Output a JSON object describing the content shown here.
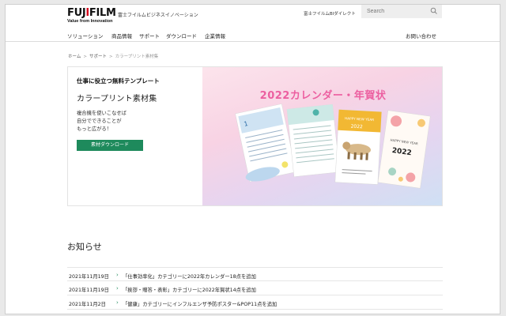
{
  "header": {
    "logo_text_pre": "FUJ",
    "logo_text_i": "I",
    "logo_text_post": "FILM",
    "logo_tagline": "Value from Innovation",
    "sub_brand": "富士フイルムビジネスイノベーション",
    "bi_direct": "富士フイルムBIダイレクト",
    "search_placeholder": "Search",
    "search_icon": "search-icon"
  },
  "nav": {
    "items": [
      {
        "label": "ソリューション"
      },
      {
        "label": "商品情報"
      },
      {
        "label": "サポート"
      },
      {
        "label": "ダウンロード"
      },
      {
        "label": "企業情報"
      }
    ],
    "contact": "お問い合わせ"
  },
  "breadcrumb": {
    "items": [
      "ホーム",
      "サポート",
      "カラープリント素材集"
    ],
    "separator": ">"
  },
  "hero": {
    "kicker": "仕事に役立つ無料テンプレート",
    "title": "カラープリント素材集",
    "desc_lines": [
      "複合機を使いこなせば",
      "自分でできることが",
      "もっと広がる！"
    ],
    "button_label": "素材ダウンロード",
    "banner_title": "2022カレンダー・年賀状",
    "card_texts": {
      "cal1_month": "1",
      "hny1": "HAPPY NEW YEAR",
      "year1": "2022",
      "hny2": "HAPPY NEW YEAR",
      "year2": "2022"
    }
  },
  "news": {
    "heading": "お知らせ",
    "items": [
      {
        "date": "2021年11月19日",
        "text": "「仕事効率化」カテゴリーに2022年カレンダー18点を追加"
      },
      {
        "date": "2021年11月19日",
        "text": "「挨拶・贈答・表彰」カテゴリーに2022年賀状14点を追加"
      },
      {
        "date": "2021年11月2日",
        "text": "「健康」カテゴリーにインフルエンザ予防ポスター&POP11点を追加"
      }
    ],
    "arrow": "›"
  },
  "colors": {
    "accent_green": "#1e8a5c",
    "brand_red": "#d6001c",
    "banner_pink": "#ec5fa0"
  }
}
